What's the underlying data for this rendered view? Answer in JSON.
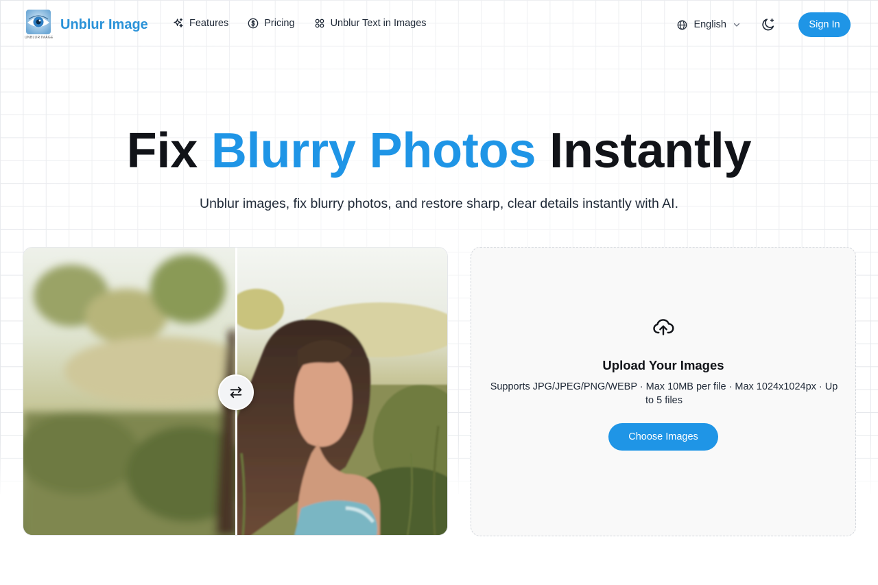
{
  "header": {
    "logo_caption": "UNBLUR IMAGE",
    "brand_name": "Unblur Image",
    "nav": [
      {
        "label": "Features",
        "icon": "sparkles-icon"
      },
      {
        "label": "Pricing",
        "icon": "dollar-circle-icon"
      },
      {
        "label": "Unblur Text in Images",
        "icon": "grid-icon"
      }
    ],
    "language": "English",
    "theme_icon": "moon-sparkle-icon",
    "sign_in_label": "Sign In"
  },
  "hero": {
    "title_prefix": "Fix ",
    "title_accent": "Blurry Photos",
    "title_suffix": " Instantly",
    "subtitle": "Unblur images, fix blurry photos, and restore sharp, clear details instantly with AI."
  },
  "compare": {
    "handle_icon": "swap-arrows-icon",
    "split_fraction": 0.5
  },
  "upload": {
    "icon": "cloud-upload-icon",
    "title": "Upload Your Images",
    "description": "Supports JPG/JPEG/PNG/WEBP · Max 10MB per file · Max 1024x1024px · Up to 5 files",
    "button_label": "Choose Images"
  },
  "colors": {
    "accent": "#1f95e6",
    "brand": "#2a92d8",
    "heading": "#111318"
  }
}
